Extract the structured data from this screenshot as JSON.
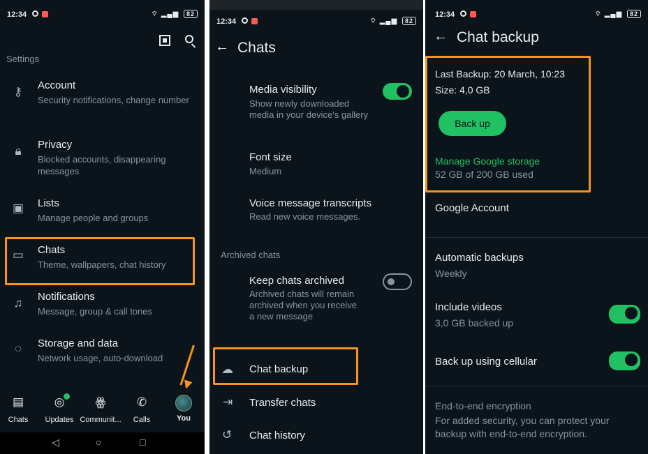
{
  "status": {
    "time": "12:34",
    "battery": "82"
  },
  "panel1": {
    "section_label": "Settings",
    "items": [
      {
        "title": "Account",
        "sub": "Security notifications, change number",
        "icon": "key-icon"
      },
      {
        "title": "Privacy",
        "sub": "Blocked accounts, disappearing messages",
        "icon": "lock-icon"
      },
      {
        "title": "Lists",
        "sub": "Manage people and groups",
        "icon": "contacts-icon"
      },
      {
        "title": "Chats",
        "sub": "Theme, wallpapers, chat history",
        "icon": "chat-icon"
      },
      {
        "title": "Notifications",
        "sub": "Message, group & call tones",
        "icon": "bell-icon"
      },
      {
        "title": "Storage and data",
        "sub": "Network usage, auto-download",
        "icon": "storage-icon"
      }
    ],
    "nav": [
      {
        "label": "Chats",
        "icon": "chats-icon"
      },
      {
        "label": "Updates",
        "icon": "updates-icon"
      },
      {
        "label": "Communit...",
        "icon": "communities-icon"
      },
      {
        "label": "Calls",
        "icon": "calls-icon"
      },
      {
        "label": "You",
        "icon": "avatar"
      }
    ]
  },
  "panel2": {
    "title": "Chats",
    "media_visibility": {
      "title": "Media visibility",
      "sub": "Show newly downloaded media in your device's gallery"
    },
    "font_size": {
      "title": "Font size",
      "sub": "Medium"
    },
    "voice": {
      "title": "Voice message transcripts",
      "sub": "Read new voice messages."
    },
    "archived_label": "Archived chats",
    "keep_archived": {
      "title": "Keep chats archived",
      "sub": "Archived chats will remain archived when you receive a new message"
    },
    "chat_backup": "Chat backup",
    "transfer": "Transfer chats",
    "history": "Chat history"
  },
  "panel3": {
    "title": "Chat backup",
    "last_backup": "Last Backup: 20 March, 10:23",
    "size": "Size: 4,0 GB",
    "backup_button": "Back up",
    "manage_storage": "Manage Google storage",
    "storage_used": "52 GB of 200 GB used",
    "google_account": "Google Account",
    "auto_backups": {
      "title": "Automatic backups",
      "sub": "Weekly"
    },
    "include_videos": {
      "title": "Include videos",
      "sub": "3,0 GB backed up"
    },
    "cellular": "Back up using cellular",
    "e2e": {
      "title": "End-to-end encryption",
      "sub": "For added security, you can protect your backup with end-to-end encryption."
    }
  },
  "colors": {
    "accent": "#21c063",
    "highlight": "#f7931e",
    "background": "#0b141a"
  }
}
